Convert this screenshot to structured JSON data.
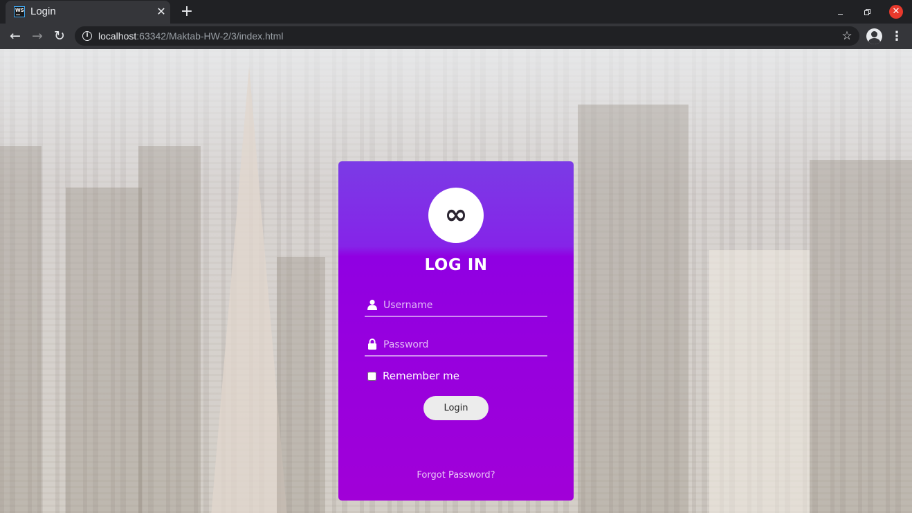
{
  "browser": {
    "tab": {
      "title": "Login",
      "favicon_text": "WS",
      "close_glyph": "✕"
    },
    "new_tab_glyph": "+",
    "window_controls": {
      "close_glyph": "✕"
    },
    "nav": {
      "back_glyph": "←",
      "forward_glyph": "→",
      "reload_glyph": "↻"
    },
    "address": {
      "host": "localhost",
      "rest": ":63342/Maktab-HW-2/3/index.html"
    },
    "star_glyph": "☆",
    "menu_glyph": "⋮"
  },
  "icons": {
    "logo": "infinity-icon",
    "username": "user-icon",
    "password": "lock-icon"
  },
  "page": {
    "logo_glyph": "∞",
    "heading": "LOG IN",
    "username": {
      "placeholder": "Username",
      "value": ""
    },
    "password": {
      "placeholder": "Password",
      "value": ""
    },
    "remember_label": "Remember me",
    "remember_checked": false,
    "login_button": "Login",
    "forgot_link": "Forgot Password?"
  },
  "colors": {
    "card_top": "#7b3be6",
    "card_bottom": "#a100d8",
    "button_bg": "#ececec",
    "browser_frame": "#202124",
    "close_button": "#e8392c"
  }
}
